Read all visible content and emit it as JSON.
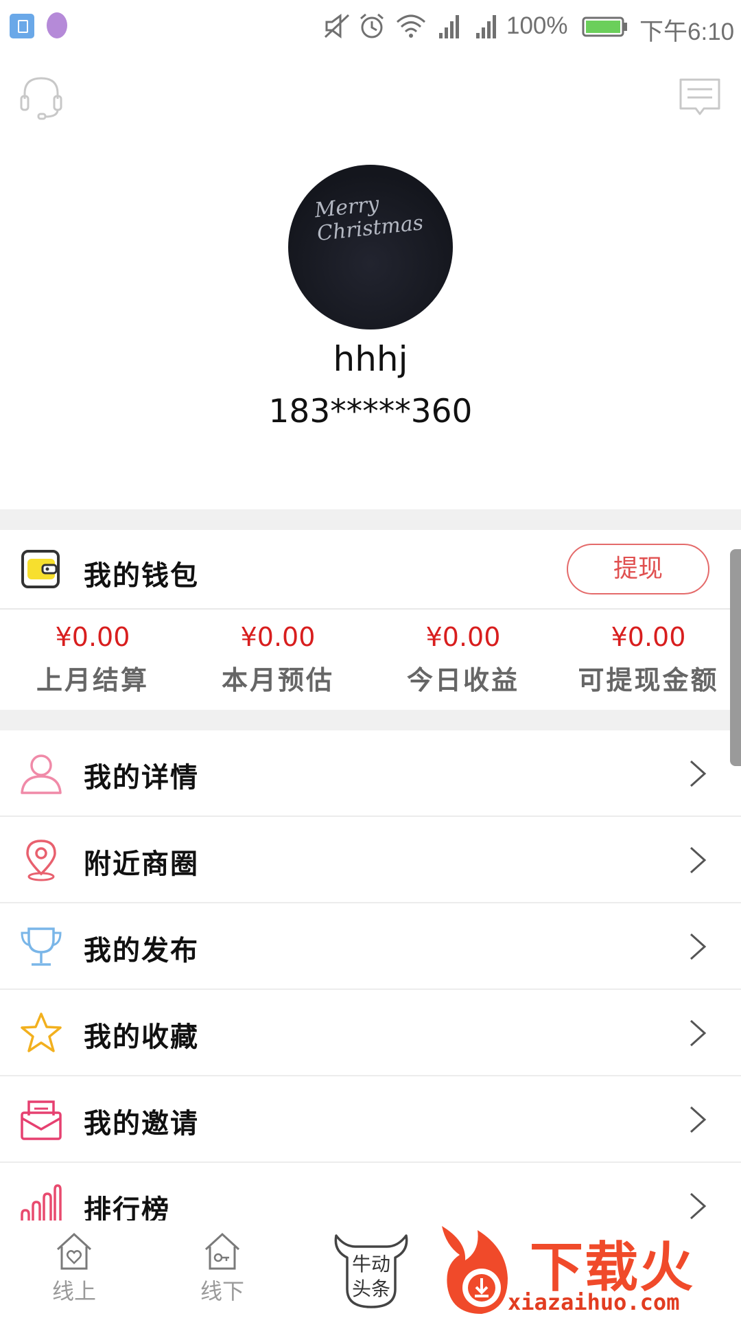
{
  "status_bar": {
    "battery": "100%",
    "time": "下午6:10"
  },
  "profile": {
    "avatar_text": "Merry Christmas",
    "name": "hhhj",
    "phone": "183*****360"
  },
  "wallet": {
    "label": "我的钱包",
    "withdraw_button": "提现",
    "stats": [
      {
        "value": "¥0.00",
        "label": "上月结算"
      },
      {
        "value": "¥0.00",
        "label": "本月预估"
      },
      {
        "value": "¥0.00",
        "label": "今日收益"
      },
      {
        "value": "¥0.00",
        "label": "可提现金额"
      }
    ]
  },
  "menu": [
    {
      "label": "我的详情",
      "icon": "person-icon",
      "color": "#f08aa8"
    },
    {
      "label": "附近商圈",
      "icon": "location-pin-icon",
      "color": "#e8606e"
    },
    {
      "label": "我的发布",
      "icon": "trophy-icon",
      "color": "#7ab6e8"
    },
    {
      "label": "我的收藏",
      "icon": "star-icon",
      "color": "#f2b01e"
    },
    {
      "label": "我的邀请",
      "icon": "envelope-icon",
      "color": "#e64070"
    },
    {
      "label": "排行榜",
      "icon": "bar-ranking-icon",
      "color": "#e84a6e"
    }
  ],
  "bottom_nav": [
    {
      "label": "线上",
      "icon": "home-heart-icon"
    },
    {
      "label": "线下",
      "icon": "home-key-icon"
    },
    {
      "label": "牛动头条",
      "icon": "bull-icon"
    }
  ],
  "watermark": {
    "brand": "下载火",
    "url": "xiazaihuo.com"
  },
  "colors": {
    "accent_red": "#d81e1e",
    "withdraw_border": "#e46a6a",
    "background_gap": "#f0f0f0"
  }
}
